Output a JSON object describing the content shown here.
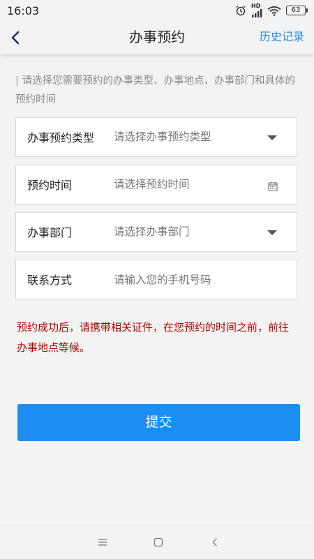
{
  "status_bar": {
    "time": "16:03",
    "network_label": "HD",
    "battery": "63",
    "icons": [
      "alarm-icon",
      "signal-icon",
      "wifi-icon",
      "battery-icon"
    ]
  },
  "header": {
    "title": "办事预约",
    "history_link": "历史记录",
    "back_icon": "chevron-left-icon"
  },
  "hint": {
    "prefix": "|",
    "text": "请选择您需要预约的办事类型、办事地点、办事部门和具体的预约时间"
  },
  "form": {
    "type_field": {
      "label": "办事预约类型",
      "placeholder": "请选择办事预约类型",
      "icon": "caret-down-icon"
    },
    "time_field": {
      "label": "预约时间",
      "placeholder": "请选择预约时间",
      "icon": "calendar-icon"
    },
    "dept_field": {
      "label": "办事部门",
      "placeholder": "请选择办事部门",
      "icon": "caret-down-icon"
    },
    "contact_field": {
      "label": "联系方式",
      "placeholder": "请输入您的手机号码",
      "value": ""
    }
  },
  "notice": "预约成功后，请携带相关证件，在您预约的时间之前，前往办事地点等候。",
  "submit_label": "提交",
  "system_nav": {
    "items": [
      "menu-icon",
      "home-icon",
      "back-icon"
    ]
  },
  "colors": {
    "accent": "#1b8ef2",
    "link": "#1d8ae6",
    "warning_text": "#b40000",
    "background": "#f3f3f3"
  }
}
